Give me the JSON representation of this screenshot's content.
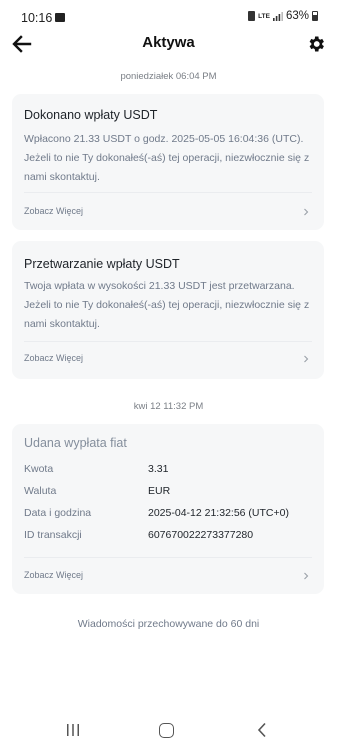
{
  "status": {
    "time": "10:16",
    "network": "LTE",
    "battery": "63%"
  },
  "header": {
    "title": "Aktywa"
  },
  "sections": [
    {
      "date": "poniedziałek 06:04 PM",
      "cards": [
        {
          "title": "Dokonano wpłaty USDT",
          "body": "Wpłacono 21.33 USDT o godz. 2025-05-05 16:04:36 (UTC). Jeżeli to nie Ty dokonałeś(-aś) tej operacji, niezwłocznie się z nami skontaktuj.",
          "link": "Zobacz Więcej"
        },
        {
          "title": "Przetwarzanie wpłaty USDT",
          "body": "Twoja wpłata w wysokości 21.33 USDT jest przetwarzana. Jeżeli to nie Ty dokonałeś(-aś) tej operacji, niezwłocznie się z nami skontaktuj.",
          "link": "Zobacz Więcej"
        }
      ]
    },
    {
      "date": "kwi 12 11:32 PM",
      "cards": [
        {
          "title": "Udana wypłata fiat",
          "rows": [
            {
              "label": "Kwota",
              "value": "3.31"
            },
            {
              "label": "Waluta",
              "value": "EUR"
            },
            {
              "label": "Data i godzina",
              "value": "2025-04-12 21:32:56 (UTC+0)"
            },
            {
              "label": "ID transakcji",
              "value": "607670022273377280"
            }
          ],
          "link": "Zobacz Więcej"
        }
      ]
    }
  ],
  "footer_note": "Wiadomości przechowywane do 60 dni"
}
